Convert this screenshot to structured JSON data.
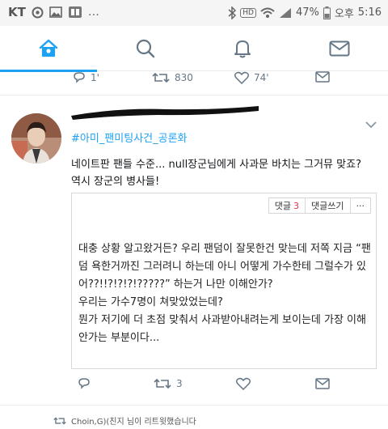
{
  "status_bar": {
    "carrier": "KT",
    "right_text": "47%",
    "ampm": "오후",
    "time": "5:16",
    "network": "HD",
    "signal_tag": "6"
  },
  "nav": {
    "tabs": [
      {
        "name": "home",
        "icon": "home-icon",
        "active": true
      },
      {
        "name": "search",
        "icon": "search-icon",
        "active": false
      },
      {
        "name": "notifications",
        "icon": "bell-icon",
        "active": false
      },
      {
        "name": "messages",
        "icon": "mail-icon",
        "active": false
      }
    ],
    "accent_color": "#1da1f2"
  },
  "prev_tweet": {
    "reply_count": "1'",
    "retweet_count": "830",
    "like_count": "74'"
  },
  "tweet": {
    "hashtag": "#아미_팬미팅사건_공론화",
    "text": "네이트판 팬들 수준... null장군님에게 사과문 바치는 그거뮤 맞죠? 역시 장군의 병사들!",
    "card": {
      "reply_label": "댓글",
      "reply_count": "3",
      "write_label": "댓글쓰기",
      "more_label": "···",
      "body_lines": [
        "대충 상황 알고왔거든? 우리 팬덤이 잘못한건 맞는데 저쪽 지금 “팬덤 욕한거까진 그러려니 하는데 아니 어떻게 가수한테 그럴수가 있어??!!?!?!?!?????” 하는거 나만 이해안가?",
        "우리는 가수7명이 쳐맞았었는데?",
        "뭔가 저기에 더 초점 맞춰서 사과받아내려는게 보이는데 가장 이해안가는 부분이다..."
      ]
    },
    "retweet_count": "3"
  },
  "retweet_note": "Choin,G)(친지 님이 리트윗했습니다"
}
